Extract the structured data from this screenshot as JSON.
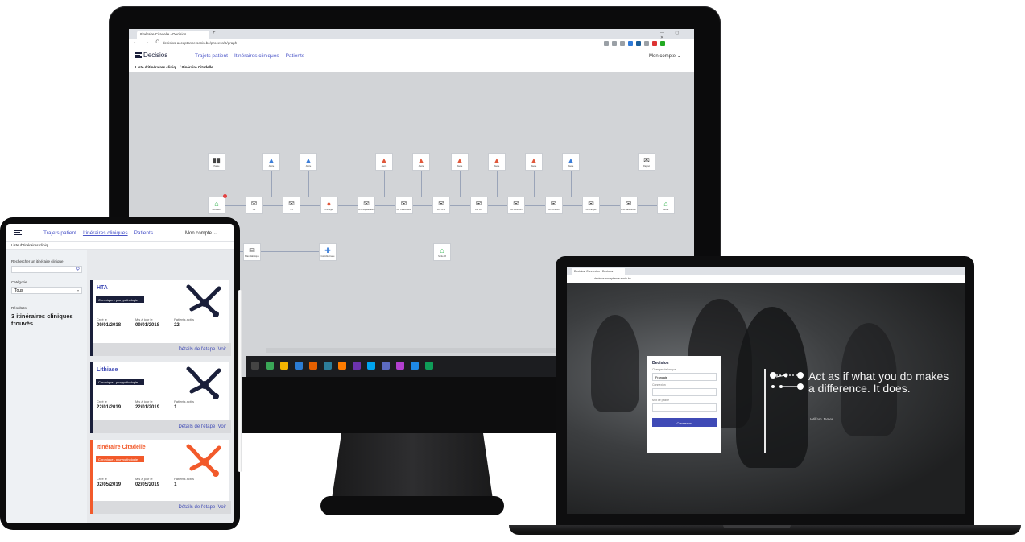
{
  "desktop": {
    "browser": {
      "tab_title": "Itinéraire Citadelle - Decisios",
      "new_tab": "+",
      "window_controls": "— ▢ ✕",
      "nav_buttons": "← → C",
      "url": "decisios-acceptance.sonix.be/process/6/graph"
    },
    "app": {
      "logo_text": "Decisios",
      "nav": [
        "Trajets patient",
        "Itinéraires cliniques",
        "Patients"
      ],
      "account": "Mon compte ⌄",
      "breadcrumb": "Liste d'itinéraires cliniq...   /  Itinéraire Citadelle"
    },
    "graph": {
      "top_row": [
        {
          "icon": "pause-icon",
          "label": "Pause"
        },
        {
          "icon": "warning-blue-icon",
          "label": "Alerte"
        },
        {
          "icon": "warning-blue-icon",
          "label": "Alerte"
        },
        {
          "icon": "warning-red-icon",
          "label": "Alerte"
        },
        {
          "icon": "warning-red-icon",
          "label": "Alerte"
        },
        {
          "icon": "warning-red-icon",
          "label": "Alerte"
        },
        {
          "icon": "warning-red-icon",
          "label": "Alerte"
        },
        {
          "icon": "warning-red-icon",
          "label": "Alerte"
        },
        {
          "icon": "warning-blue-icon",
          "label": "Alerte"
        },
        {
          "icon": "envelope-icon",
          "label": "Rappel"
        }
      ],
      "main_row": [
        {
          "icon": "bank-icon",
          "label": "Activation"
        },
        {
          "icon": "envelope-icon",
          "label": "J-2"
        },
        {
          "icon": "envelope-icon",
          "label": "J-1"
        },
        {
          "icon": "person-icon",
          "label": "Chirurgie"
        },
        {
          "icon": "envelope-icon",
          "label": "J+1 hospitalisation"
        },
        {
          "icon": "envelope-icon",
          "label": "J+7 Cicatrisation"
        },
        {
          "icon": "envelope-icon",
          "label": "J+3 J+10"
        },
        {
          "icon": "envelope-icon",
          "label": "J+1 J+3"
        },
        {
          "icon": "envelope-icon",
          "label": "J+1 Evolution"
        },
        {
          "icon": "envelope-icon",
          "label": "J+3 Fonction"
        },
        {
          "icon": "envelope-icon",
          "label": "J+7 Fatigue"
        },
        {
          "icon": "envelope-icon",
          "label": "J+14 Satisfaction"
        },
        {
          "icon": "home-icon",
          "label": "Sortie"
        }
      ],
      "bottom_row": [
        {
          "icon": "envelope-icon",
          "label": "Bilan diabétique"
        },
        {
          "icon": "signpost-icon",
          "label": "Contrôle Image"
        },
        {
          "icon": "bank-icon",
          "label": "Sortie J3"
        }
      ],
      "badge": "1"
    }
  },
  "tablet": {
    "logo_text": "",
    "nav": [
      "Trajets patient",
      "Itinéraires cliniques",
      "Patients"
    ],
    "account": "Mon compte ⌄",
    "breadcrumb": "Liste d'itinéraires cliniq...",
    "search_label": "Rechercher un itinéraire clinique",
    "search_placeholder": "",
    "category_label": "Catégorie",
    "category_value": "Tous",
    "results_label": "Résultats",
    "results_text": "3 itinéraires cliniques trouvés",
    "cards": [
      {
        "title": "HTA",
        "tag": "Chronique - plurypathologie",
        "created_label": "Créé le",
        "created": "09/01/2018",
        "updated_label": "Mis à jour le",
        "updated": "09/01/2018",
        "patients_label": "Patients actifs",
        "patients": "22",
        "details": "Détails de l'étape",
        "view": "Voir"
      },
      {
        "title": "Lithiase",
        "tag": "Chronique - plurypathologie",
        "created_label": "Créé le",
        "created": "22/01/2019",
        "updated_label": "Mis à jour le",
        "updated": "22/01/2019",
        "patients_label": "Patients actifs",
        "patients": "1",
        "details": "Détails de l'étape",
        "view": "Voir"
      },
      {
        "title": "Itinéraire Citadelle",
        "tag": "Chronique - plurypathologie",
        "created_label": "Créé le",
        "created": "02/05/2019",
        "updated_label": "Mis à jour le",
        "updated": "02/05/2019",
        "patients_label": "Patients actifs",
        "patients": "1",
        "details": "Détails de l'étape",
        "view": "Voir"
      }
    ],
    "colors": {
      "accent": "#3f4ab6",
      "highlight": "#f25a2b",
      "navy": "#1a1f3a"
    }
  },
  "laptop": {
    "tab_title": "Decisios, Connexion - Decisios",
    "url": "decisios-acceptance.sonix.be",
    "login": {
      "title": "Decisios",
      "language_label": "Changer de langue",
      "language_value": "Français",
      "login_label": "Connexion",
      "password_label": "Mot de passe",
      "button": "Connexion"
    },
    "quote": "Act as if what you do makes a difference. It does.",
    "author": "William James"
  }
}
